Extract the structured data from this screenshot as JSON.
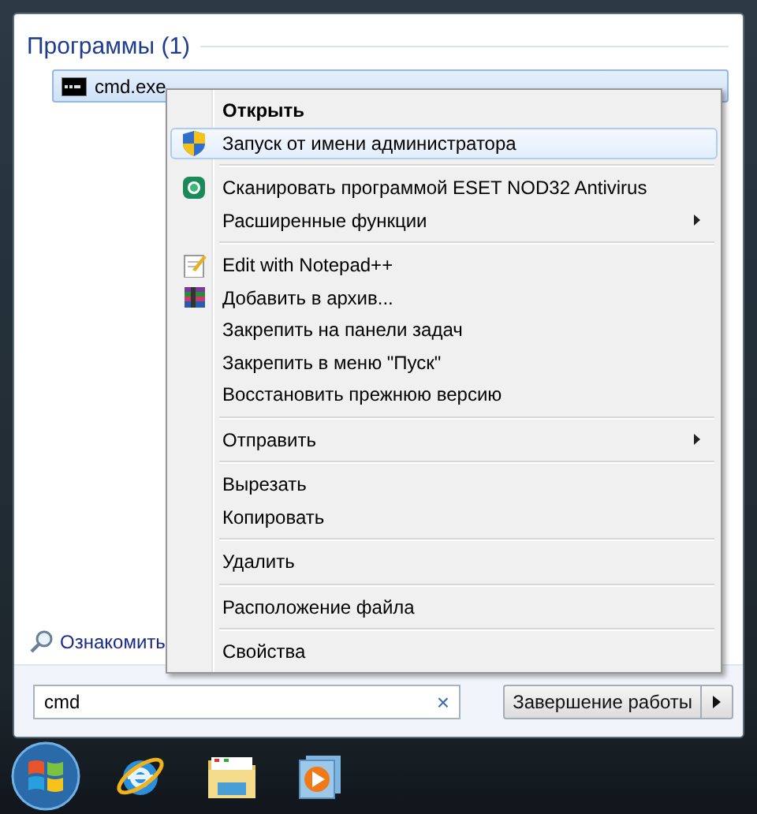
{
  "results": {
    "heading": "Программы (1)",
    "items": [
      {
        "label": "cmd.exe",
        "selected": true
      }
    ]
  },
  "see_more_link": "Ознакомить",
  "search": {
    "value": "cmd",
    "clear": "×"
  },
  "shutdown_button": "Завершение работы",
  "context_menu": {
    "groups": [
      {
        "items": [
          {
            "label": "Открыть",
            "bold": true,
            "selected": false,
            "submenu": false
          },
          {
            "label": "Запуск от имени администратора",
            "bold": false,
            "selected": true,
            "submenu": false,
            "kind": "shield"
          }
        ]
      },
      {
        "items": [
          {
            "label": "Сканировать программой ESET NOD32 Antivirus",
            "bold": false,
            "selected": false,
            "submenu": false,
            "kind": "scanner"
          },
          {
            "label": "Расширенные функции",
            "bold": false,
            "selected": false,
            "submenu": true
          }
        ]
      },
      {
        "items": [
          {
            "label": "Edit with Notepad++",
            "bold": false,
            "selected": false,
            "submenu": false,
            "kind": "notepad"
          },
          {
            "label": "Добавить в архив...",
            "bold": false,
            "selected": false,
            "submenu": false,
            "kind": "archive"
          },
          {
            "label": "Закрепить на панели задач",
            "bold": false,
            "selected": false,
            "submenu": false
          },
          {
            "label": "Закрепить в меню \"Пуск\"",
            "bold": false,
            "selected": false,
            "submenu": false
          },
          {
            "label": "Восстановить прежнюю версию",
            "bold": false,
            "selected": false,
            "submenu": false
          }
        ]
      },
      {
        "items": [
          {
            "label": "Отправить",
            "bold": false,
            "selected": false,
            "submenu": true
          }
        ]
      },
      {
        "items": [
          {
            "label": "Вырезать",
            "bold": false,
            "selected": false,
            "submenu": false
          },
          {
            "label": "Копировать",
            "bold": false,
            "selected": false,
            "submenu": false
          }
        ]
      },
      {
        "items": [
          {
            "label": "Удалить",
            "bold": false,
            "selected": false,
            "submenu": false
          }
        ]
      },
      {
        "items": [
          {
            "label": "Расположение файла",
            "bold": false,
            "selected": false,
            "submenu": false
          }
        ]
      },
      {
        "items": [
          {
            "label": "Свойства",
            "bold": false,
            "selected": false,
            "submenu": false
          }
        ]
      }
    ]
  },
  "taskbar": {
    "items": [
      {
        "kind": "start"
      },
      {
        "kind": "browser"
      },
      {
        "kind": "folder"
      },
      {
        "kind": "player"
      }
    ]
  }
}
